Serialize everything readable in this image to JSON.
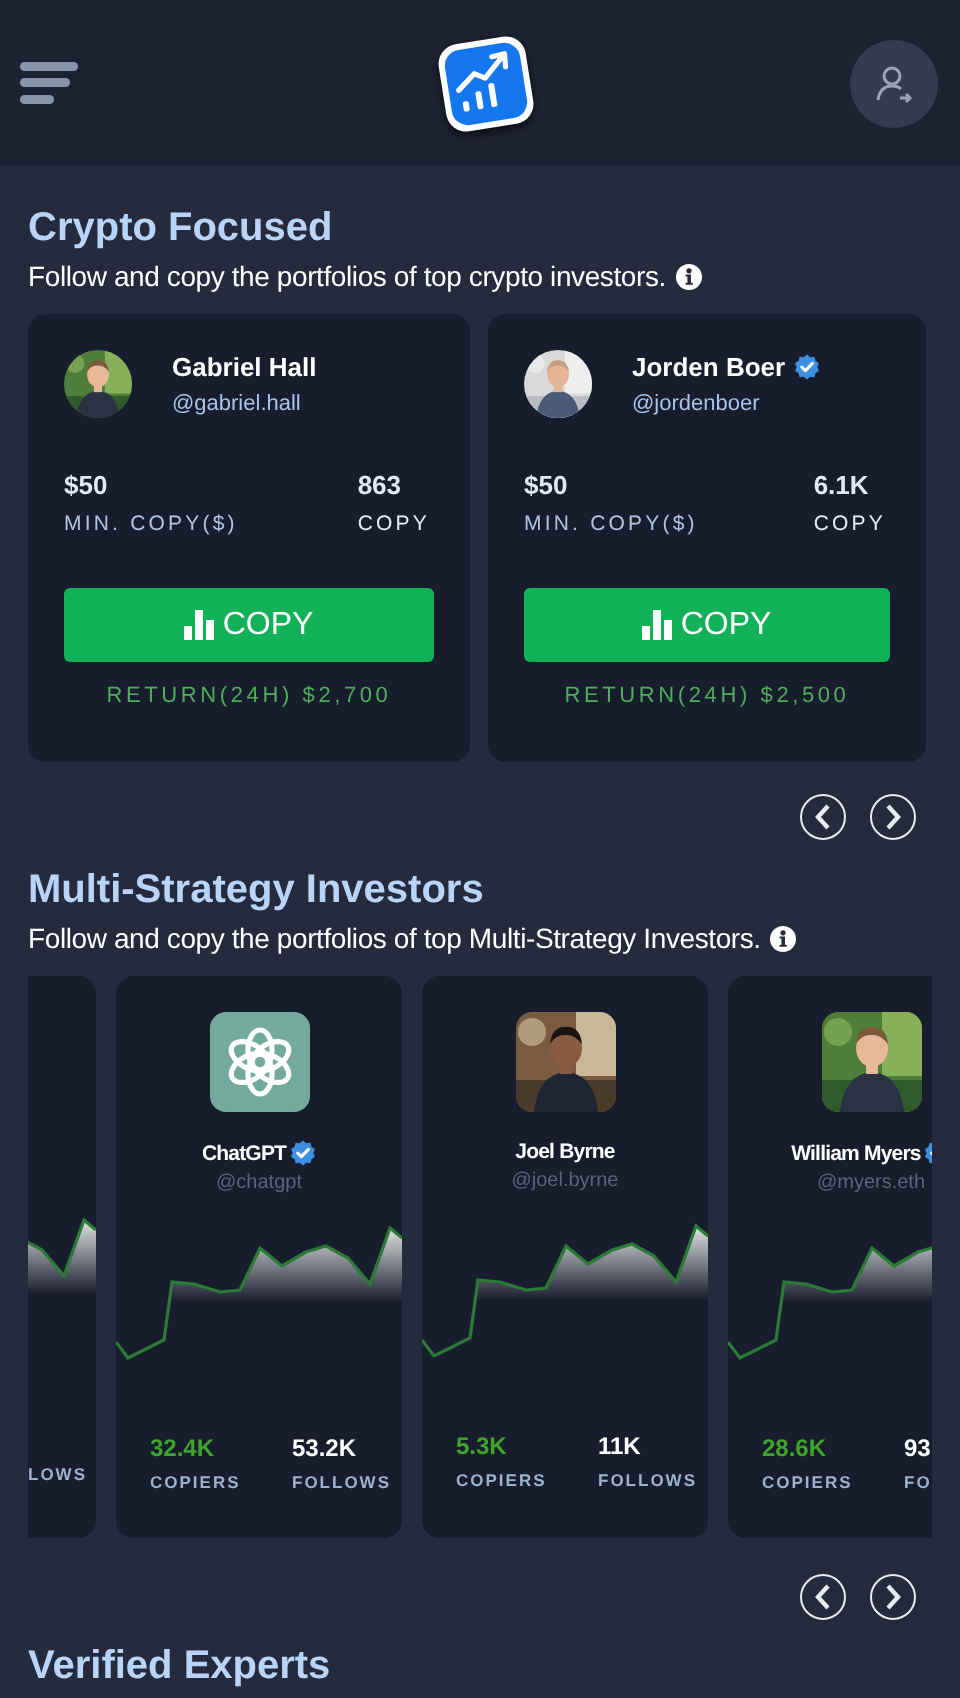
{
  "sections": [
    {
      "kind": "copy",
      "title": "Crypto Focused",
      "subtitle": "Follow and copy the portfolios of top crypto investors.",
      "traders": [
        {
          "name": "Gabriel Hall",
          "handle": "@gabriel.hall",
          "verified": false,
          "min_copy": "$50",
          "min_copy_label": "MIN. COPY($)",
          "copies": "863",
          "copies_label": "COPY",
          "button": "COPY",
          "return": "RETURN(24H) $2,700"
        },
        {
          "name": "Jorden Boer",
          "handle": "@jordenboer",
          "verified": true,
          "min_copy": "$50",
          "min_copy_label": "MIN. COPY($)",
          "copies": "6.1K",
          "copies_label": "COPY",
          "button": "COPY",
          "return": "RETURN(24H) $2,500"
        }
      ]
    },
    {
      "kind": "stats",
      "title": "Multi-Strategy Investors",
      "subtitle": "Follow and copy the portfolios of top Multi-Strategy Investors.",
      "traders": [
        {
          "kind": "partial",
          "follows_label": "LOWS"
        },
        {
          "kind": "logo",
          "name": "ChatGPT",
          "handle": "@chatgpt",
          "verified": true,
          "copiers": "32.4K",
          "copiers_label": "COPIERS",
          "follows": "53.2K",
          "follows_label": "FOLLOWS"
        },
        {
          "name": "Joel Byrne",
          "handle": "@joel.byrne",
          "verified": false,
          "copiers": "5.3K",
          "copiers_label": "COPIERS",
          "follows": "11K",
          "follows_label": "FOLLOWS"
        },
        {
          "name": "William Myers",
          "handle": "@myers.eth",
          "verified": true,
          "copiers": "28.6K",
          "copiers_label": "COPIERS",
          "follows": "93",
          "follows_label": "FO"
        }
      ]
    },
    {
      "kind": "heading",
      "title": "Verified Experts"
    }
  ]
}
